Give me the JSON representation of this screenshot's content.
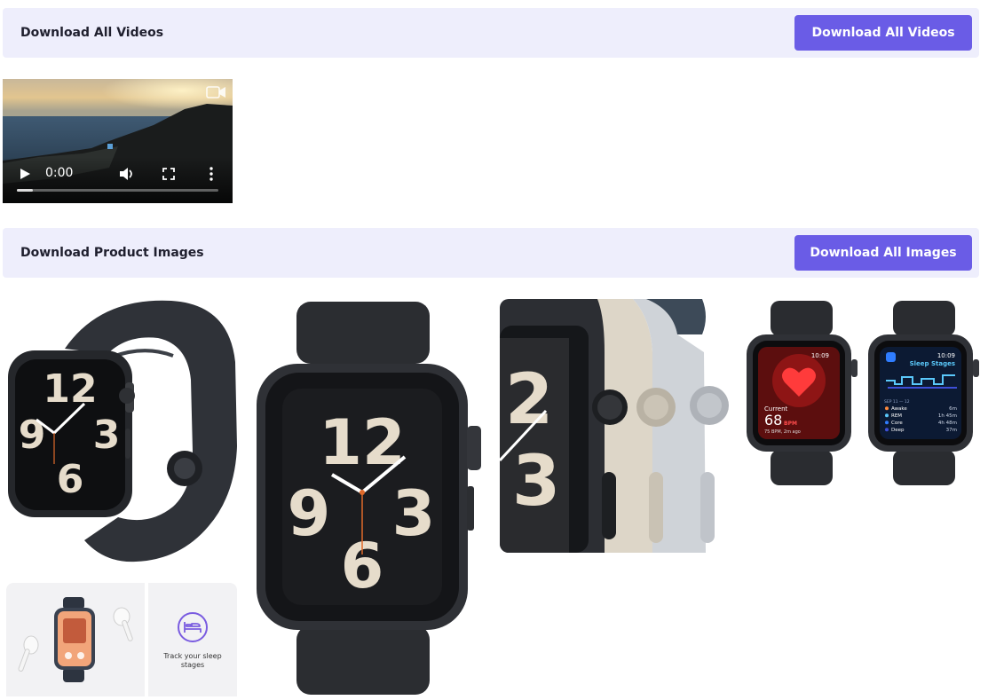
{
  "videos_section": {
    "title": "Download All Videos",
    "button_label": "Download All Videos"
  },
  "video": {
    "time": "0:00",
    "progress": 0.08
  },
  "images_section": {
    "title": "Download Product Images",
    "button_label": "Download All Images"
  },
  "images": {
    "img1_hour": "12",
    "img2_hour": "12",
    "heart_screen": {
      "label": "Current",
      "value": "68",
      "unit": "BPM",
      "sub": "75 BPM, 2m ago",
      "time": "10:09"
    },
    "sleep_screen": {
      "time": "10:09",
      "title": "Sleep Stages",
      "date": "SEP 11 — 12",
      "rows": [
        {
          "label": "Awake",
          "value": "6m",
          "color": "#ff8a3d"
        },
        {
          "label": "REM",
          "value": "1h 45m",
          "color": "#5ac8fa"
        },
        {
          "label": "Core",
          "value": "4h 48m",
          "color": "#2f7dff"
        },
        {
          "label": "Deep",
          "value": "37m",
          "color": "#3d4fd6"
        }
      ]
    },
    "sleep_tile_text": "Track your sleep stages"
  },
  "colors": {
    "accent": "#6a5ce6",
    "bar_bg": "#eeeefc",
    "watch_case": "#2a2d33",
    "dial_numeral": "#e6dccb",
    "starlight": "#ddd6c8",
    "silver": "#d6d8dc"
  }
}
